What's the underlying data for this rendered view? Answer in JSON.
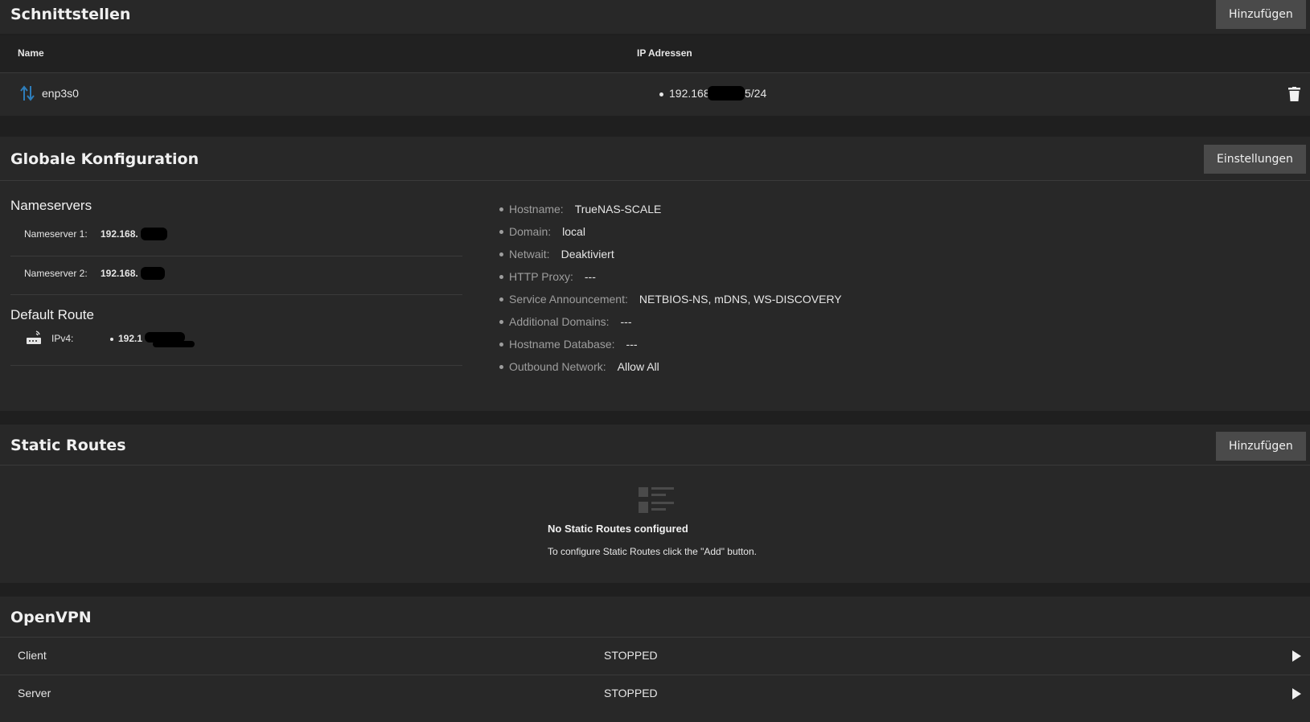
{
  "interfaces": {
    "title": "Schnittstellen",
    "add_label": "Hinzufügen",
    "col_name": "Name",
    "col_ip": "IP Adressen",
    "rows": [
      {
        "name": "enp3s0",
        "ip": "192.168.",
        "ip_suffix": "5/24"
      }
    ]
  },
  "global": {
    "title": "Globale Konfiguration",
    "settings_label": "Einstellungen",
    "nameservers_title": "Nameservers",
    "nameservers": [
      {
        "label": "Nameserver 1:",
        "value": "192.168."
      },
      {
        "label": "Nameserver 2:",
        "value": "192.168."
      }
    ],
    "default_route_title": "Default Route",
    "default_route": {
      "label": "IPv4:",
      "value": "192.1"
    },
    "info": [
      {
        "label": "Hostname:",
        "value": "TrueNAS-SCALE"
      },
      {
        "label": "Domain:",
        "value": "local"
      },
      {
        "label": "Netwait:",
        "value": "Deaktiviert"
      },
      {
        "label": "HTTP Proxy:",
        "value": "---"
      },
      {
        "label": "Service Announcement:",
        "value": "NETBIOS-NS, mDNS, WS-DISCOVERY"
      },
      {
        "label": "Additional Domains:",
        "value": "---"
      },
      {
        "label": "Hostname Database:",
        "value": "---"
      },
      {
        "label": "Outbound Network:",
        "value": "Allow All"
      }
    ]
  },
  "static_routes": {
    "title": "Static Routes",
    "add_label": "Hinzufügen",
    "empty_title": "No Static Routes configured",
    "empty_text": "To configure Static Routes click the \"Add\" button."
  },
  "openvpn": {
    "title": "OpenVPN",
    "rows": [
      {
        "name": "Client",
        "status": "STOPPED"
      },
      {
        "name": "Server",
        "status": "STOPPED"
      }
    ]
  },
  "colors": {
    "background": "#1f1f1f",
    "card": "#282828",
    "button": "#4a4a4a",
    "interface_icon": "#2e7dba"
  }
}
